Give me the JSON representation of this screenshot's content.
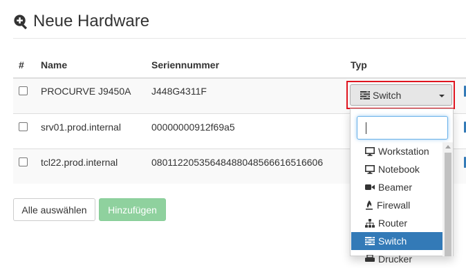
{
  "page": {
    "title": "Neue Hardware",
    "title_icon": "zoom-in-icon"
  },
  "table": {
    "headers": {
      "number": "#",
      "name": "Name",
      "serial": "Seriennummer",
      "type": "Typ"
    },
    "rows": [
      {
        "checked": false,
        "name": "PROCURVE J9450A",
        "serial": "J448G4311F"
      },
      {
        "checked": false,
        "name": "srv01.prod.internal",
        "serial": "00000000912f69a5"
      },
      {
        "checked": false,
        "name": "tcl22.prod.internal",
        "serial": "08011220535648488048566616516606"
      }
    ]
  },
  "type_select": {
    "selected": "Switch",
    "selected_icon": "switch-icon",
    "search_value": "",
    "options": [
      {
        "label": "Workstation",
        "icon": "monitor-icon"
      },
      {
        "label": "Notebook",
        "icon": "monitor-icon"
      },
      {
        "label": "Beamer",
        "icon": "video-camera-icon"
      },
      {
        "label": "Firewall",
        "icon": "fire-icon"
      },
      {
        "label": "Router",
        "icon": "sitemap-icon"
      },
      {
        "label": "Switch",
        "icon": "switch-icon",
        "selected": true
      },
      {
        "label": "Drucker",
        "icon": "printer-icon"
      }
    ]
  },
  "buttons": {
    "select_all": "Alle auswählen",
    "add": "Hinzufügen"
  },
  "colors": {
    "highlight_border": "#e0141e",
    "selected_option": "#337ab7",
    "add_button": "#8fd19e"
  }
}
